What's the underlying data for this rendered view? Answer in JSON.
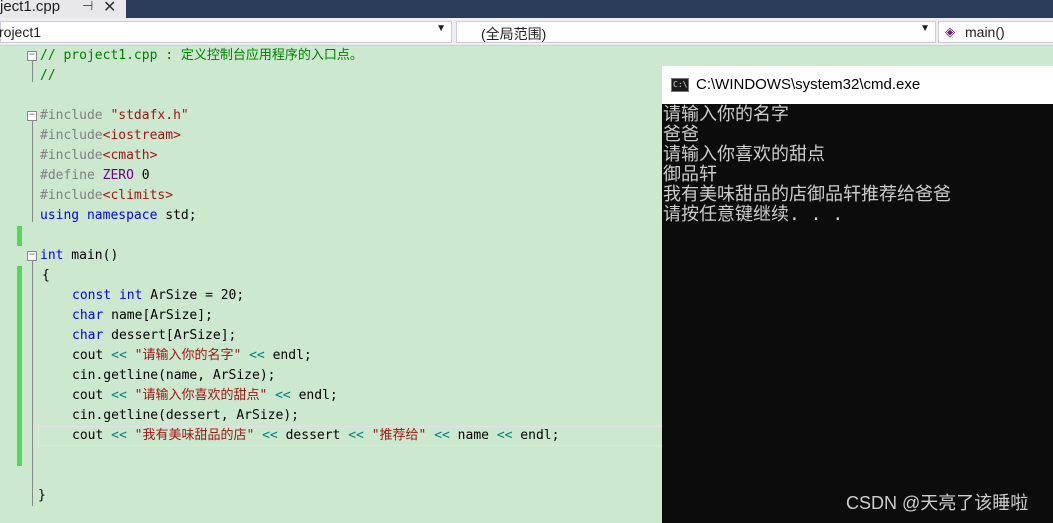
{
  "tab": {
    "title": "ject1.cpp",
    "pin_icon": "pin-icon",
    "close_icon": "close-icon"
  },
  "navbar": {
    "project": "roject1",
    "scope": "(全局范围)",
    "function": "main()",
    "function_icon": "function-cube-icon"
  },
  "code": {
    "line1": {
      "comment": "// project1.cpp : 定义控制台应用程序的入口点。"
    },
    "line2": {
      "comment": "//"
    },
    "line4": {
      "directive": "#include ",
      "path": "\"stdafx.h\""
    },
    "line5": {
      "directive": "#include",
      "path": "<iostream>"
    },
    "line6": {
      "directive": "#include",
      "path": "<cmath>"
    },
    "line7": {
      "directive": "#define ",
      "name": "ZERO",
      "value": " 0"
    },
    "line8": {
      "directive": "#include",
      "path": "<climits>"
    },
    "line9": {
      "kw1": "using",
      "sp1": " ",
      "kw2": "namespace",
      "rest": " std;"
    },
    "line11": {
      "kw": "int",
      "rest": " main()"
    },
    "line12": {
      "text": "{"
    },
    "line13": {
      "kw1": "const",
      "sp1": " ",
      "kw2": "int",
      "rest": " ArSize = 20;"
    },
    "line14": {
      "kw": "char",
      "rest": " name[ArSize];"
    },
    "line15": {
      "kw": "char",
      "rest": " dessert[ArSize];"
    },
    "line16": {
      "a": "cout ",
      "op1": "<<",
      "sp1": " ",
      "str": "\"请输入你的名字\"",
      "sp2": " ",
      "op2": "<<",
      "b": " endl;"
    },
    "line17": {
      "text": "cin.getline(name, ArSize);"
    },
    "line18": {
      "a": "cout ",
      "op1": "<<",
      "sp1": " ",
      "str": "\"请输入你喜欢的甜点\"",
      "sp2": " ",
      "op2": "<<",
      "b": " endl;"
    },
    "line19": {
      "text": "cin.getline(dessert, ArSize);"
    },
    "line20": {
      "a": "cout ",
      "op1": "<<",
      "sp1": " ",
      "str1": "\"我有美味甜品的店\"",
      "sp2": " ",
      "op2": "<<",
      "mid1": " dessert ",
      "op3": "<<",
      "sp3": " ",
      "str2": "\"推荐给\"",
      "sp4": " ",
      "op4": "<<",
      "mid2": " name ",
      "op5": "<<",
      "b": " endl;"
    },
    "line23": {
      "text": "}"
    }
  },
  "console": {
    "title": "C:\\WINDOWS\\system32\\cmd.exe",
    "icon_label": "C:\\",
    "lines": [
      "请输入你的名字",
      "爸爸",
      "请输入你喜欢的甜点",
      "御品轩",
      "我有美味甜品的店御品轩推荐给爸爸",
      "请按任意键继续. . ."
    ]
  },
  "watermark": "CSDN @天亮了该睡啦",
  "colors": {
    "editor_bg": "#cce8cf",
    "comment": "#008000",
    "string": "#a31515",
    "keyword": "#0000ff",
    "preprocessor": "#808080",
    "change_bar": "#57d65a",
    "console_bg": "#0c0c0c",
    "console_text": "#cccccc"
  }
}
